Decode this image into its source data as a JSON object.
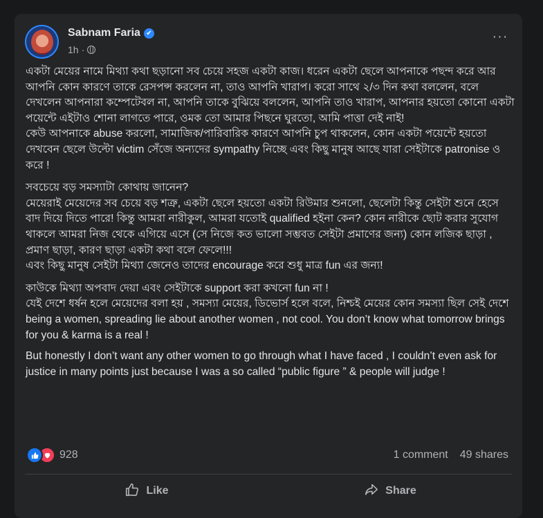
{
  "post": {
    "author": "Sabnam Faria",
    "verified_mark": "✔",
    "time": "1h",
    "separator": "·",
    "privacy_icon": "globe-icon",
    "more_label": "···",
    "paragraphs": [
      "একটা মেয়ের নামে মিথ্যা কথা ছড়ানো সব চেয়ে সহজ একটা কাজ। ধরেন একটা ছেলে আপনাকে পছন্দ করে আর আপনি কোন কারণে তাকে রেসপন্স করলেন না, তাও আপনি খারাপ। করো সাথে ২/৩ দিন কথা বললেন, বলে দেখলেন আপনারা কম্পেটেবল না, আপনি তাকে বুঝিয়ে বললেন, আপনি তাও খারাপ, আপনার হয়তো কোনো একটা পয়েন্টে এইটাও শোনা লাগতে পারে, ওমক তো আমার পিছনে ঘুরতো, আমি পাত্তা দেই নাই!\nকেউ আপনাকে abuse করলো, সামাজিক/পারিবারিক কারণে আপনি চুপ থাকলেন, কোন একটা পয়েন্টে হয়তো দেখবেন ছেলে উল্টো victim সেঁজে অন্যদের sympathy নিচ্ছে এবং কিছু মানুষ আছে যারা সেইটাকে patronise ও করে !",
      "সবচেয়ে বড় সমস্যাটা কোথায় জানেন?\nমেয়েরাই মেয়েদের সব চেয়ে বড় শত্রু, একটা ছেলে হয়তো একটা রিউমার শুনলো, ছেলেটা কিন্তু সেইটা শুনে হেসে বাদ দিয়ে দিতে পারে! কিন্তু আমরা নারীকুল, আমরা যতোই qualified হইনা কেন? কোন নারীকে ছোট করার সুযোগ থাকলে আমরা নিজ থেকে এগিয়ে এসে (সে নিজে কত ভালো সম্ভবত সেইটা প্রমাণের জন্য) কোন লজিক ছাড়া , প্রমাণ ছাড়া, কারণ ছাড়া একটা কথা বলে ফেলে!!!\nএবং কিছু মানুষ সেইটা মিথ্যা জেনেও তাদের encourage করে শুধু মাত্র fun এর জন্য!",
      "কাউকে মিথ্যা অপবাদ দেয়া এবং সেইটাকে support করা কখনো fun না !\nযেই দেশে ধর্ষন হলে মেয়েদের বলা হয় , সমস্যা মেয়ের, ডিভোর্স হলে বলে, নিশ্চই মেয়ের কোন সমস্যা ছিল সেই দেশে being a women, spreading lie about another women , not cool. You don’t know what tomorrow brings for you & karma is a real !",
      "But honestly I don’t want any other women to go through what I have faced , I couldn’t even ask for justice in many points just because I was a so called “public figure ” & people will judge !"
    ]
  },
  "stats": {
    "reaction_count": "928",
    "comments": "1 comment",
    "shares": "49 shares"
  },
  "actions": {
    "like_label": "Like",
    "share_label": "Share"
  },
  "colors": {
    "background": "#18191a",
    "card": "#242526",
    "text": "#e4e6eb",
    "secondary": "#b0b3b8",
    "like_blue": "#1877f2",
    "love_red": "#f33e58"
  }
}
